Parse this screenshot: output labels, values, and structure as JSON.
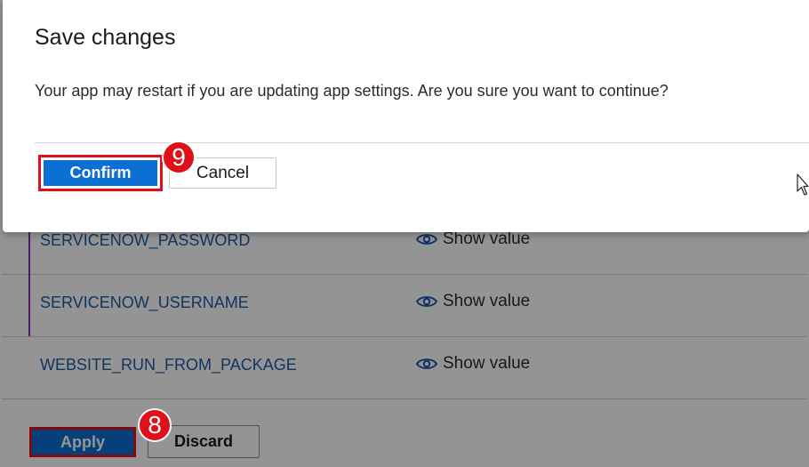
{
  "dialog": {
    "title": "Save changes",
    "message": "Your app may restart if you are updating app settings. Are you sure you want to continue?",
    "confirm_label": "Confirm",
    "cancel_label": "Cancel"
  },
  "settings": {
    "rows": [
      {
        "name": "SERVICENOW_PASSWORD",
        "action": "Show value",
        "icon": "eye-icon"
      },
      {
        "name": "SERVICENOW_USERNAME",
        "action": "Show value",
        "icon": "eye-icon"
      },
      {
        "name": "WEBSITE_RUN_FROM_PACKAGE",
        "action": "Show value",
        "icon": "eye-icon"
      }
    ]
  },
  "footer": {
    "apply_label": "Apply",
    "discard_label": "Discard"
  },
  "annotations": {
    "step_confirm": "9",
    "step_apply": "8"
  },
  "colors": {
    "primary_button": "#0b6fd4",
    "highlight_outline": "#e0101a",
    "link_text": "#1e5aa8",
    "row_accent": "#8a2bb0"
  }
}
